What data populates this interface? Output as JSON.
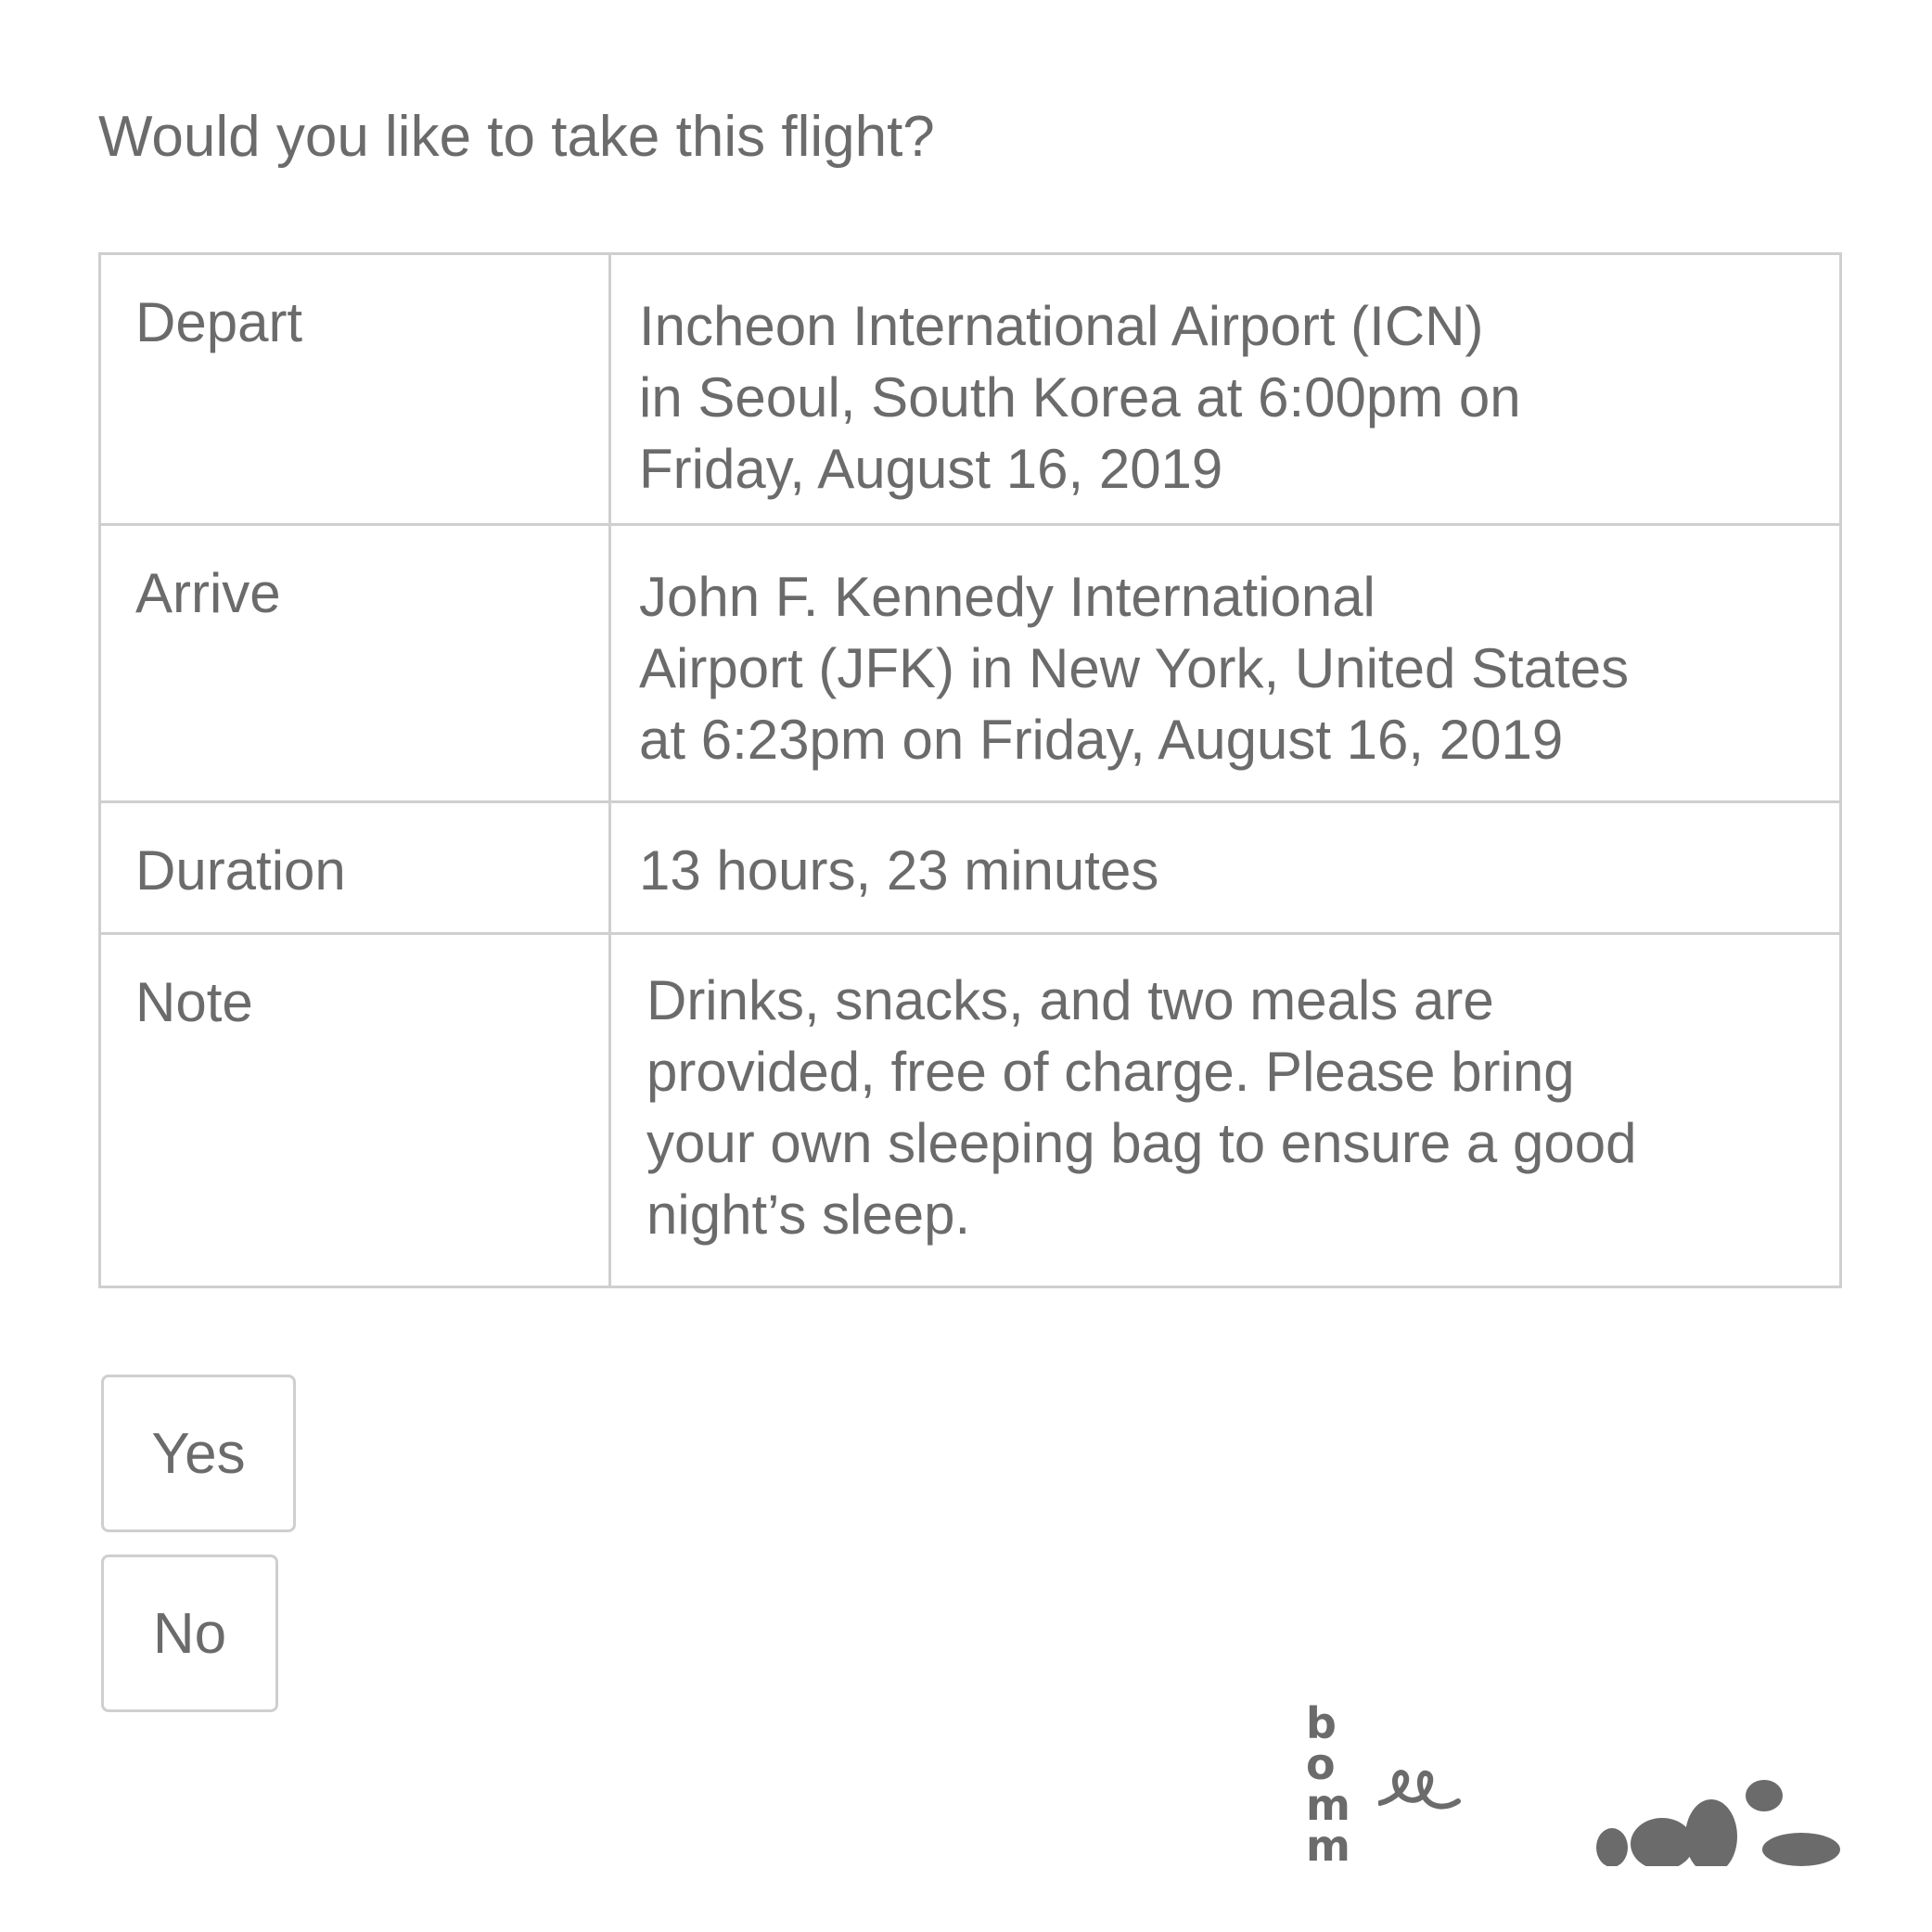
{
  "question": "Would you like to take this flight?",
  "flight": {
    "rows": [
      {
        "label": "Depart",
        "value": "Incheon International Airport (ICN)\nin Seoul, South Korea at 6:00pm on\nFriday, August 16, 2019"
      },
      {
        "label": "Arrive",
        "value": "John F. Kennedy International\nAirport (JFK) in New York, United States\nat 6:23pm on Friday, August 16, 2019"
      },
      {
        "label": "Duration",
        "value": "13 hours, 23 minutes"
      },
      {
        "label": "Note",
        "value": "Drinks, snacks, and two meals are\nprovided, free of charge. Please bring\nyour own sleeping bag to ensure a good\nnight’s sleep."
      }
    ]
  },
  "buttons": {
    "yes_label": "Yes",
    "no_label": "No"
  },
  "logos": {
    "bommee": {
      "letters": [
        "b",
        "o",
        "m",
        "m"
      ]
    },
    "stones_icon": "stones-logo-icon"
  },
  "colors": {
    "text": "#6b6b6b",
    "border": "#cfcfcf",
    "logo": "#6b6b6b",
    "background": "#ffffff"
  }
}
